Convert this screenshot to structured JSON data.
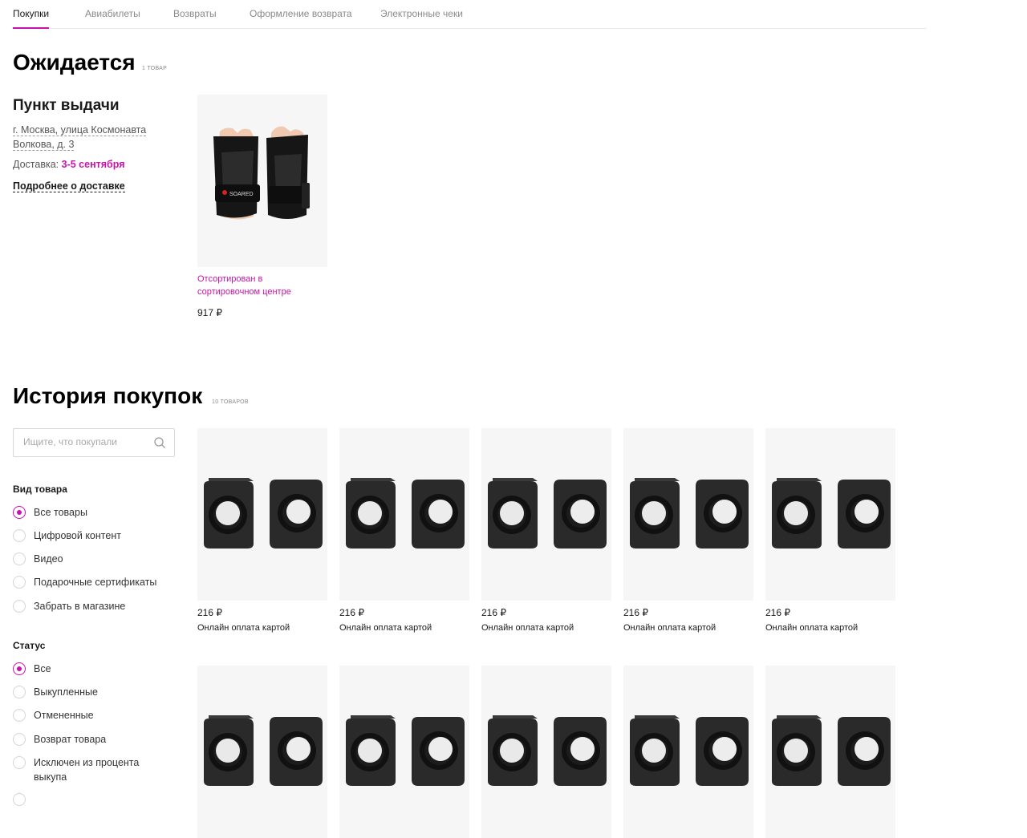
{
  "tabs": [
    "Покупки",
    "Авиабилеты",
    "Возвраты",
    "Оформление возврата",
    "Электронные чеки"
  ],
  "expected": {
    "title": "Ожидается",
    "count": "1 товар",
    "pickup_title": "Пункт выдачи",
    "address_line1": "г. Москва, улица Космонавта",
    "address_line2": "Волкова, д. 3",
    "delivery_label": "Доставка:",
    "delivery_date": "3-5 сентября",
    "more_link": "Подробнее о доставке",
    "product": {
      "status": "Отсортирован в сортировочном центре",
      "price": "917 ₽",
      "brand_text": "SOARED",
      "image_icon": "wrist-guards-image"
    }
  },
  "history": {
    "title": "История покупок",
    "count": "10 товаров",
    "search_placeholder": "Ищите, что покупали",
    "type_group": {
      "title": "Вид товара",
      "options": [
        "Все товары",
        "Цифровой контент",
        "Видео",
        "Подарочные сертификаты",
        "Забрать в магазине"
      ],
      "selected": 0
    },
    "status_group": {
      "title": "Статус",
      "options": [
        "Все",
        "Выкупленные",
        "Отмененные",
        "Возврат товара",
        "Исключен из процента выкупа"
      ],
      "selected": 0
    },
    "items": [
      {
        "price": "216 ₽",
        "payment": "Онлайн оплата картой",
        "image_icon": "speakers-image"
      },
      {
        "price": "216 ₽",
        "payment": "Онлайн оплата картой",
        "image_icon": "speakers-image"
      },
      {
        "price": "216 ₽",
        "payment": "Онлайн оплата картой",
        "image_icon": "speakers-image"
      },
      {
        "price": "216 ₽",
        "payment": "Онлайн оплата картой",
        "image_icon": "speakers-image"
      },
      {
        "price": "216 ₽",
        "payment": "Онлайн оплата картой",
        "image_icon": "speakers-image"
      },
      {
        "image_icon": "speakers-image"
      },
      {
        "image_icon": "speakers-image"
      },
      {
        "image_icon": "speakers-image"
      },
      {
        "image_icon": "speakers-image"
      },
      {
        "image_icon": "speakers-image"
      }
    ]
  },
  "colors": {
    "accent": "#cb11ab",
    "card_bg": "#f6f6f6",
    "text": "#1a1a1a",
    "muted": "#8a8a8a"
  }
}
